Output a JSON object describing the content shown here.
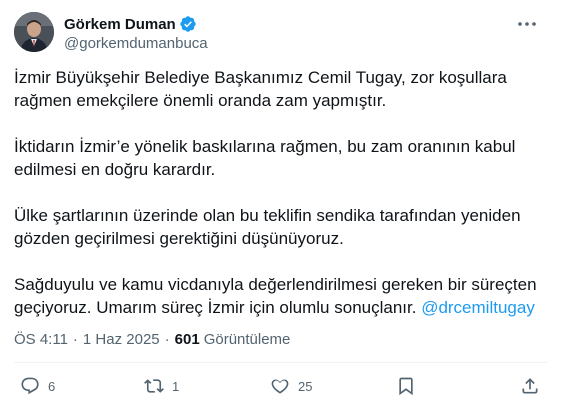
{
  "author": {
    "display_name": "Görkem Duman",
    "handle": "@gorkemdumanbuca",
    "verified_color": "#1d9bf0"
  },
  "tweet": {
    "paragraphs": [
      "İzmir Büyükşehir Belediye Başkanımız Cemil Tugay, zor koşullara rağmen emekçilere önemli oranda zam yapmıştır.",
      "İktidarın İzmir’e yönelik baskılarına rağmen, bu zam oranının kabul edilmesi en doğru karardır.",
      "Ülke şartlarının üzerinde olan bu teklifin sendika tarafından yeniden gözden geçirilmesi gerektiğini düşünüyoruz."
    ],
    "last_paragraph_text": "Sağduyulu ve kamu vicdanıyla değerlendirilmesi gereken bir süreçten geçiyoruz. Umarım süreç İzmir için olumlu sonuçlanır. ",
    "mention": "@drcemiltugay"
  },
  "meta": {
    "time": "ÖS 4:11",
    "separator": "·",
    "date": "1 Haz 2025",
    "views_count": "601",
    "views_label": "Görüntüleme"
  },
  "actions": {
    "reply_count": "6",
    "retweet_count": "1",
    "like_count": "25"
  },
  "icons": {
    "avatar": "avatar-photo",
    "verified": "verified-badge-icon",
    "more": "more-options-icon",
    "reply": "reply-icon",
    "retweet": "retweet-icon",
    "like": "heart-icon",
    "bookmark": "bookmark-icon",
    "share": "share-icon"
  },
  "colors": {
    "text": "#0f1419",
    "secondary": "#536471",
    "link": "#1d9bf0"
  }
}
